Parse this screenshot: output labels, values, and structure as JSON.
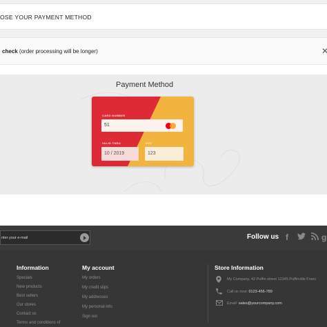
{
  "step": {
    "title": "OSE YOUR PAYMENT METHOD"
  },
  "check_option": {
    "name": "check",
    "note": " (order processing will be longer)",
    "close_icon": "close-icon"
  },
  "payment": {
    "title": "Payment Method",
    "card": {
      "number_label": "CARD NUMBER",
      "number_value": "51",
      "valid_label": "VALID THRU",
      "valid_value": "10 / 2019",
      "cvv_label": "CVV",
      "cvv_value": "123",
      "brand_icon": "mastercard-icon",
      "colors": {
        "left": "#dd2a35",
        "right": "#f2b33f"
      }
    }
  },
  "footer": {
    "newsletter": {
      "placeholder": "nter your e-mail",
      "submit_icon": "arrow-right-icon"
    },
    "follow_label": "Follow us",
    "social": [
      "facebook-icon",
      "twitter-icon",
      "rss-icon",
      "googleplus-icon"
    ],
    "information": {
      "title": "Information",
      "links": [
        "Specials",
        "New products",
        "Best sellers",
        "Our stores",
        "Contact us",
        "Terms and conditions of"
      ]
    },
    "account": {
      "title": "My account",
      "links": [
        "My orders",
        "My credit slips",
        "My addresses",
        "My personal info",
        "Sign out"
      ]
    },
    "store": {
      "title": "Store Information",
      "address": "My Company, 42 Puffin street 12345 Puffinville Franc",
      "call_prefix": "Call us now: ",
      "phone": "0123-456-789",
      "email_prefix": "Email: ",
      "email": "sales@yourcompany.com"
    }
  }
}
